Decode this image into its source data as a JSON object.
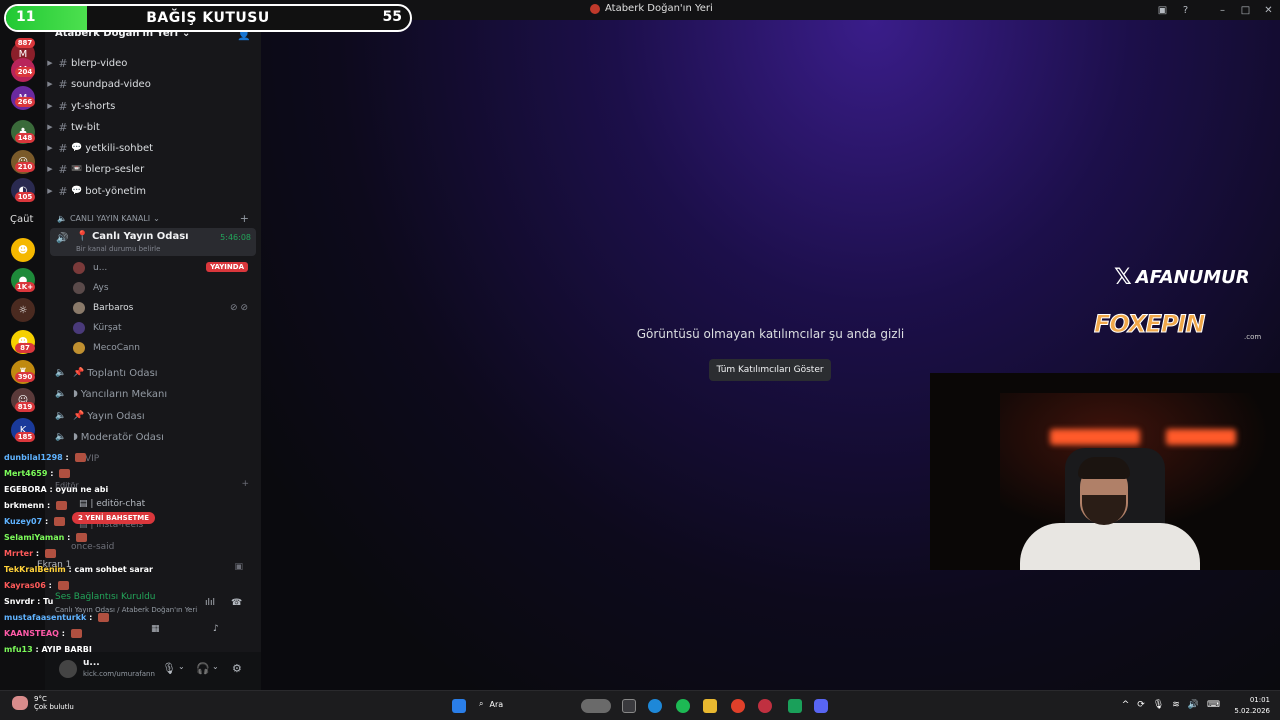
{
  "window": {
    "title": "Ataberk Doğan'ın Yeri"
  },
  "donation": {
    "left_value": "11",
    "title": "BAĞIŞ KUTUSU",
    "right_value": "55",
    "progress": 0.2
  },
  "rail": {
    "badges": [
      "887",
      "204",
      "266",
      "148",
      "210",
      "105",
      "1K+",
      "87",
      "390",
      "819",
      "185"
    ],
    "folder_label": "Çaüt"
  },
  "sidebar": {
    "server_name": "Ataberk Doğan'ın Yeri",
    "channels": [
      {
        "name": "blerp-video",
        "emoji": ""
      },
      {
        "name": "soundpad-video",
        "emoji": ""
      },
      {
        "name": "yt-shorts",
        "emoji": ""
      },
      {
        "name": "tw-bit",
        "emoji": ""
      },
      {
        "name": "yetkili-sohbet",
        "emoji": "💬"
      },
      {
        "name": "blerp-sesler",
        "emoji": "📼"
      },
      {
        "name": "bot-yönetim",
        "emoji": "💬"
      }
    ],
    "category": "CANLI YAYIN KANALI",
    "active_voice": {
      "name": "Canlı Yayın Odası",
      "status": "Bir kanal durumu belirle",
      "timer": "5:46:08"
    },
    "voice_users": [
      {
        "name": "u...",
        "live": "YAYINDA"
      },
      {
        "name": "Ays",
        "live": ""
      },
      {
        "name": "Barbaros",
        "live": ""
      },
      {
        "name": "Kürşat",
        "live": ""
      },
      {
        "name": "MecoCann",
        "live": ""
      }
    ],
    "voice_channels": [
      "Toplantı Odası",
      "Yancıların Mekanı",
      "Yayın Odası",
      "Moderatör Odası"
    ],
    "faint_items": [
      "VIP",
      "Editör",
      "editör-chat",
      "insta-reels",
      "once-said",
      "Ekran 1"
    ],
    "mentions": "2 YENİ BAHSETME",
    "voice_connected": "Ses Bağlantısı Kuruldu",
    "voice_connected_sub": "Canlı Yayın Odası / Ataberk Doğan'ın Yeri",
    "user": {
      "name": "u...",
      "sub": "kick.com/umurafann"
    }
  },
  "stage": {
    "hidden_message": "Görüntüsü olmayan katılımcılar şu anda gizli",
    "show_all_button": "Tüm Katılımcıları Göster",
    "brand_x": "AFANUMUR",
    "brand_fox": "FOXEPIN",
    "brand_fox_sub": ".com"
  },
  "chat": [
    {
      "user": "dunbilal1298",
      "msg": "",
      "color": "#5fb3ff",
      "emote": true
    },
    {
      "user": "Mert4659",
      "msg": "",
      "color": "#7cfc5a",
      "emote": true
    },
    {
      "user": "EGEBORA",
      "msg": "oyun ne abi",
      "color": "#ffffff",
      "emote": false
    },
    {
      "user": "brkmenn",
      "msg": "",
      "color": "#ffffff",
      "emote": true
    },
    {
      "user": "Kuzey07",
      "msg": "",
      "color": "#5fb3ff",
      "emote": true
    },
    {
      "user": "SelamiYaman",
      "msg": "",
      "color": "#7cfc5a",
      "emote": true
    },
    {
      "user": "Mrrter",
      "msg": "",
      "color": "#ff5a5a",
      "emote": true
    },
    {
      "user": "TekKralBenim",
      "msg": "cam sohbet sarar",
      "color": "#ffd23a",
      "emote": false
    },
    {
      "user": "Kayras06",
      "msg": "",
      "color": "#ff5a5a",
      "emote": true
    },
    {
      "user": "Snvrdr",
      "msg": "Tu",
      "color": "#ffffff",
      "emote": false
    },
    {
      "user": "mustafaasenturkk",
      "msg": "",
      "color": "#5fb3ff",
      "emote": true
    },
    {
      "user": "KAANSTEAQ",
      "msg": "",
      "color": "#ff5aa8",
      "emote": true
    },
    {
      "user": "mfu13",
      "msg": "AYIP BARBI",
      "color": "#7cfc5a",
      "emote": false
    }
  ],
  "taskbar": {
    "temp": "9°C",
    "weather": "Çok bulutlu",
    "search": "Ara",
    "time": "01:01",
    "date": "5.02.2026"
  }
}
